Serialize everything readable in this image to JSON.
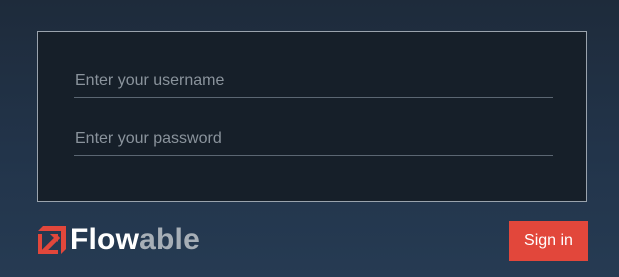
{
  "login_form": {
    "username": {
      "value": "",
      "placeholder": "Enter your username"
    },
    "password": {
      "value": "",
      "placeholder": "Enter your password"
    }
  },
  "brand": {
    "logo_text_part1": "Flow",
    "logo_text_part2": "able",
    "logo_icon": "flowable-logo-icon",
    "accent_color": "#e2473b"
  },
  "actions": {
    "sign_in_label": "Sign in"
  }
}
